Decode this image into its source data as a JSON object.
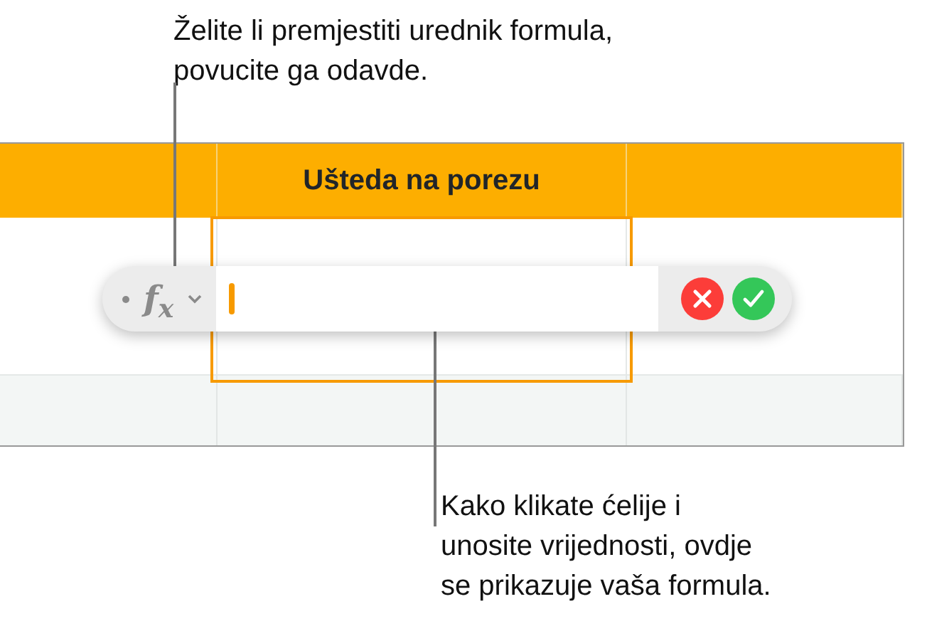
{
  "top_callout": "Želite li premjestiti urednik formula,\npovucite ga odavde.",
  "bottom_callout": "Kako klikate ćelije i\nunosite vrijednosti, ovdje\nse prikazuje vaša formula.",
  "table": {
    "columns": [
      {
        "selected": false
      },
      {
        "heading": "Ušteda na porezu",
        "selected": true
      },
      {
        "selected": false
      }
    ]
  },
  "formula_editor": {
    "function_symbol": "f$_{x}$"
  }
}
